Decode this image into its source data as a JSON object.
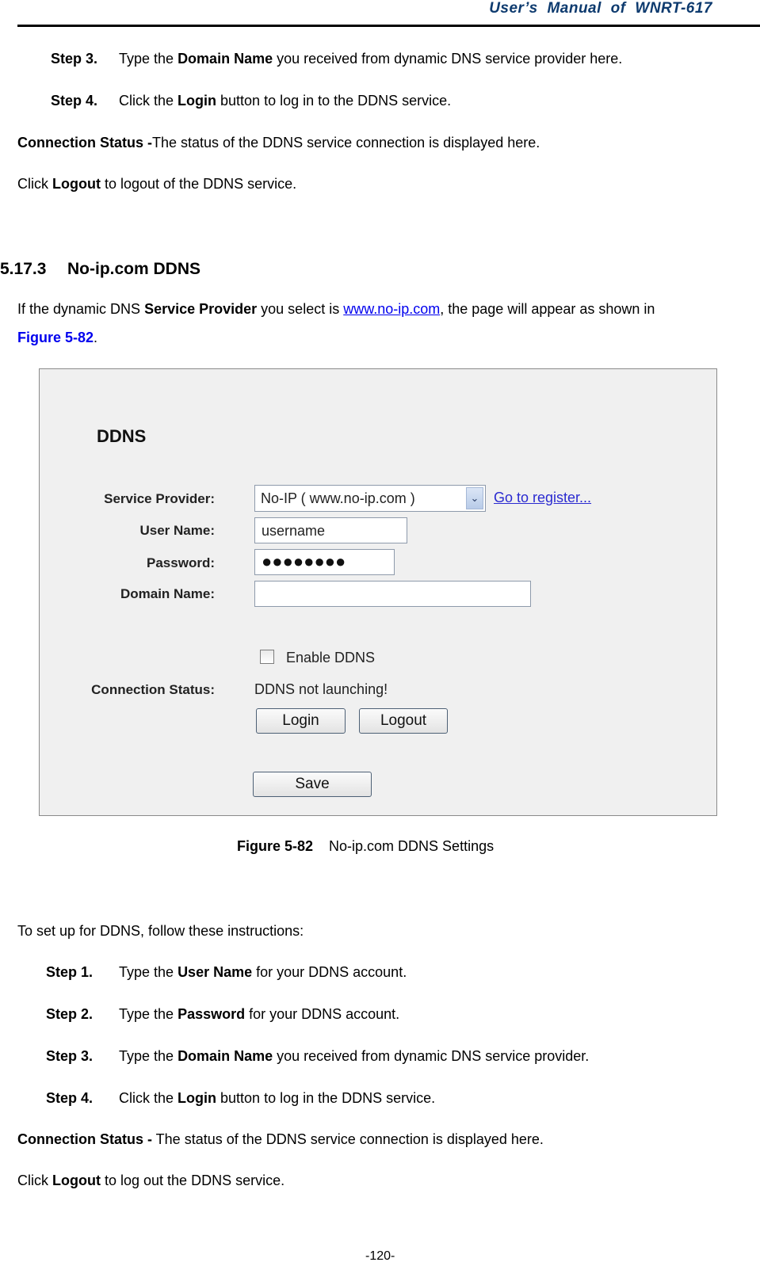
{
  "header": {
    "title": "User’s  Manual  of  WNRT-617"
  },
  "top_section": {
    "steps": [
      {
        "label": "Step 3.",
        "pre": "Type the ",
        "bold": "Domain Name",
        "post": " you received from dynamic DNS service provider here."
      },
      {
        "label": "Step 4.",
        "pre": "Click the ",
        "bold": "Login",
        "post": " button to log in to the DDNS service."
      }
    ],
    "connection_status": {
      "bold": "Connection Status -",
      "text": "The status of the DDNS service connection is displayed here."
    },
    "logout_note": {
      "pre": "Click ",
      "bold": "Logout",
      "post": " to logout of the DDNS service."
    }
  },
  "section": {
    "number": "5.17.3",
    "title": "No-ip.com DDNS",
    "intro": {
      "pre": "If the dynamic DNS ",
      "bold": "Service Provider",
      "mid": " you select is ",
      "link": "www.no-ip.com",
      "post": ", the page will appear as shown in",
      "figref": "Figure 5-82",
      "end": "."
    }
  },
  "figure": {
    "title": "DDNS",
    "fields": {
      "service_provider_label": "Service Provider:",
      "service_provider_value": "No-IP ( www.no-ip.com )",
      "register_link": "Go to register...",
      "user_name_label": "User Name:",
      "user_name_value": "username",
      "password_label": "Password:",
      "password_value": "●●●●●●●●",
      "domain_name_label": "Domain Name:",
      "domain_name_value": "",
      "enable_ddns_label": "Enable DDNS",
      "enable_ddns_checked": false,
      "connection_status_label": "Connection Status:",
      "connection_status_value": "DDNS not launching!"
    },
    "buttons": {
      "login": "Login",
      "logout": "Logout",
      "save": "Save"
    },
    "caption_label": "Figure 5-82",
    "caption_text": "No-ip.com DDNS Settings"
  },
  "instructions": {
    "intro": "To set up for DDNS, follow these instructions:",
    "steps": [
      {
        "label": "Step 1.",
        "pre": "Type the ",
        "bold": "User Name",
        "post": " for your DDNS account."
      },
      {
        "label": "Step 2.",
        "pre": "Type the ",
        "bold": "Password",
        "post": " for your DDNS account."
      },
      {
        "label": "Step 3.",
        "pre": "Type the ",
        "bold": "Domain Name",
        "post": " you received from dynamic DNS service provider."
      },
      {
        "label": "Step 4.",
        "pre": "Click the ",
        "bold": "Login",
        "post": " button to log in the DDNS service."
      }
    ],
    "connection_status": {
      "bold": "Connection Status -",
      "text": " The status of the DDNS service connection is displayed here."
    },
    "logout_note": {
      "pre": "Click ",
      "bold": "Logout",
      "post": " to log out the DDNS service."
    }
  },
  "footer": {
    "page_number": "-120-"
  },
  "colors": {
    "header_text": "#0d3a6e",
    "link": "#0000ee",
    "figure_bg": "#f0f0f0"
  }
}
